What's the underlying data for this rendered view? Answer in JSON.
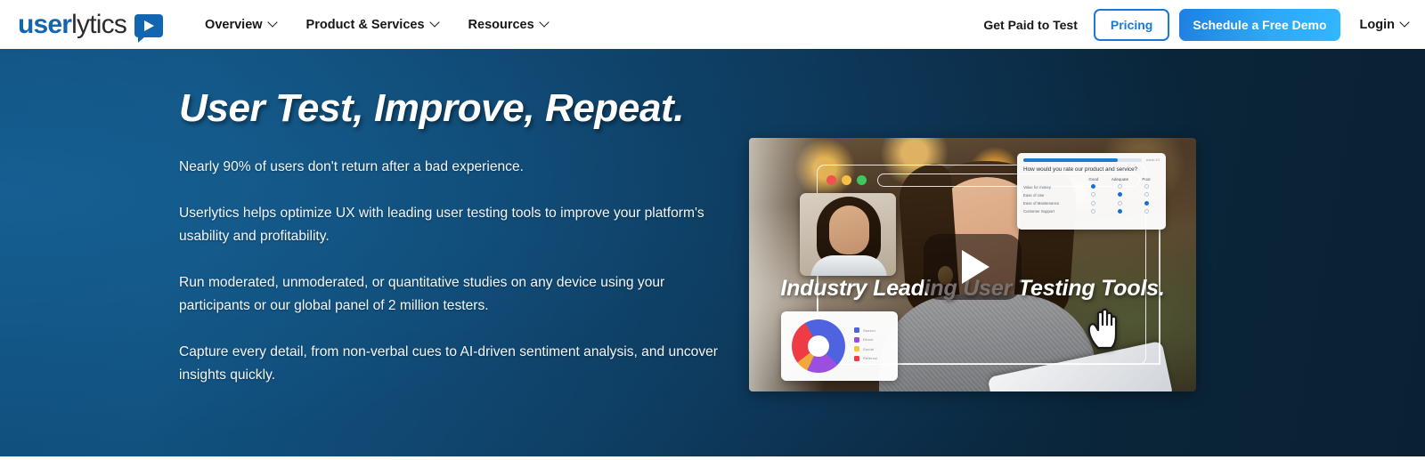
{
  "navbar": {
    "logo": {
      "part1": "user",
      "part2": "lytics",
      "mark_icon": "play-bubble-icon"
    },
    "menu": [
      {
        "label": "Overview",
        "caret": "chevron-down-icon"
      },
      {
        "label": "Product & Services",
        "caret": "chevron-down-icon"
      },
      {
        "label": "Resources",
        "caret": "chevron-down-icon"
      }
    ],
    "get_paid_label": "Get Paid to Test",
    "pricing_label": "Pricing",
    "demo_label": "Schedule a Free Demo",
    "login_label": "Login",
    "colors": {
      "logo_blue": "#1266b0",
      "pricing_border": "#1a79d6",
      "demo_gradient_start": "#1f7fe0",
      "demo_gradient_end": "#32b7ff"
    }
  },
  "hero": {
    "headline": "User Test, Improve, Repeat.",
    "paragraphs": [
      "Nearly 90% of users don't return after a bad experience.",
      "Userlytics helps optimize UX with leading user testing tools to improve your platform's usability and profitability.",
      "Run moderated, unmoderated, or quantitative studies on any device using your participants or our global panel of 2 million testers.",
      "Capture every detail, from non-verbal cues to AI-driven sentiment analysis, and uncover insights quickly."
    ],
    "background": {
      "left_color": "#0f4f7d",
      "right_color": "#0a2133"
    }
  },
  "video": {
    "overlay_title": "Industry Leading User Testing Tools.",
    "play_icon": "play-button-icon",
    "cursor_icon": "hand-pointer-icon",
    "browser": {
      "dots": [
        "red",
        "yellow",
        "green"
      ],
      "url_placeholder": ""
    },
    "survey": {
      "counter": "Admin 2/3",
      "question": "How would you rate our product and service?",
      "columns": [
        "Good",
        "Adequate",
        "Poor"
      ],
      "rows": [
        {
          "label": "Value for money",
          "selected": 0
        },
        {
          "label": "Ease of Use",
          "selected": 1
        },
        {
          "label": "Ease of Maintenance",
          "selected": 2
        },
        {
          "label": "Customer Support",
          "selected": 1
        }
      ]
    },
    "chart_data": {
      "type": "pie",
      "title": "",
      "categories": [
        "Search",
        "Direct",
        "Social",
        "Referral"
      ],
      "values": [
        37,
        19,
        8,
        27
      ],
      "colors": [
        "#4f63e0",
        "#9b4fe0",
        "#f0a93a",
        "#ef3b46"
      ],
      "legend_position": "right",
      "donut": true
    }
  }
}
